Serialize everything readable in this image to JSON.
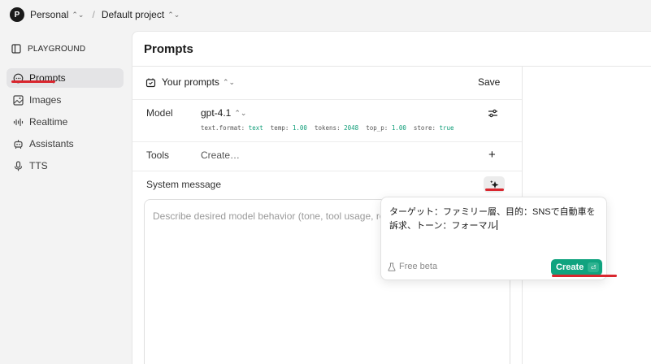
{
  "topbar": {
    "org_initial": "P",
    "org_name": "Personal",
    "separator": "/",
    "project_name": "Default project"
  },
  "sidebar": {
    "section": "PLAYGROUND",
    "items": [
      {
        "label": "Prompts",
        "icon": "chat-bubble-icon",
        "active": true
      },
      {
        "label": "Images",
        "icon": "image-icon"
      },
      {
        "label": "Realtime",
        "icon": "waveform-icon"
      },
      {
        "label": "Assistants",
        "icon": "robot-icon"
      },
      {
        "label": "TTS",
        "icon": "microphone-icon"
      }
    ]
  },
  "main": {
    "title": "Prompts",
    "your_prompts": "Your prompts",
    "save": "Save",
    "model_label": "Model",
    "model_name": "gpt-4.1",
    "params": [
      {
        "key": "text.format:",
        "val": "text"
      },
      {
        "key": "temp:",
        "val": "1.00"
      },
      {
        "key": "tokens:",
        "val": "2048"
      },
      {
        "key": "top_p:",
        "val": "1.00"
      },
      {
        "key": "store:",
        "val": "true"
      }
    ],
    "tools_label": "Tools",
    "tools_value": "Create…",
    "system_label": "System message",
    "system_placeholder": "Describe desired model behavior (tone, tool usage, response style)"
  },
  "popup": {
    "text": "ターゲット：ファミリー層、目的：SNSで自動車を訴求、トーン：フォーマル",
    "beta": "Free beta",
    "create": "Create",
    "kbd": "⏎"
  },
  "colors": {
    "accent_green": "#10a37f",
    "annotation_red": "#d9262e"
  }
}
